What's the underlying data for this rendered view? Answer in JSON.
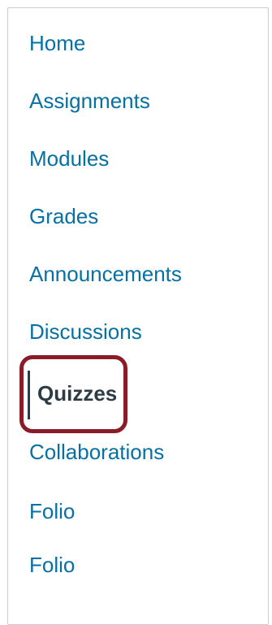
{
  "course_nav": {
    "items": [
      {
        "label": "Home",
        "active": false
      },
      {
        "label": "Assignments",
        "active": false
      },
      {
        "label": "Modules",
        "active": false
      },
      {
        "label": "Grades",
        "active": false
      },
      {
        "label": "Announcements",
        "active": false
      },
      {
        "label": "Discussions",
        "active": false
      },
      {
        "label": "Quizzes",
        "active": true
      },
      {
        "label": "Collaborations",
        "active": false
      },
      {
        "label": "Folio",
        "active": false
      },
      {
        "label": "Folio",
        "active": false
      }
    ]
  },
  "colors": {
    "link": "#0770a3",
    "active_text": "#2d3b45",
    "highlight_border": "#8a1c27",
    "panel_border": "#c7cdd1"
  }
}
